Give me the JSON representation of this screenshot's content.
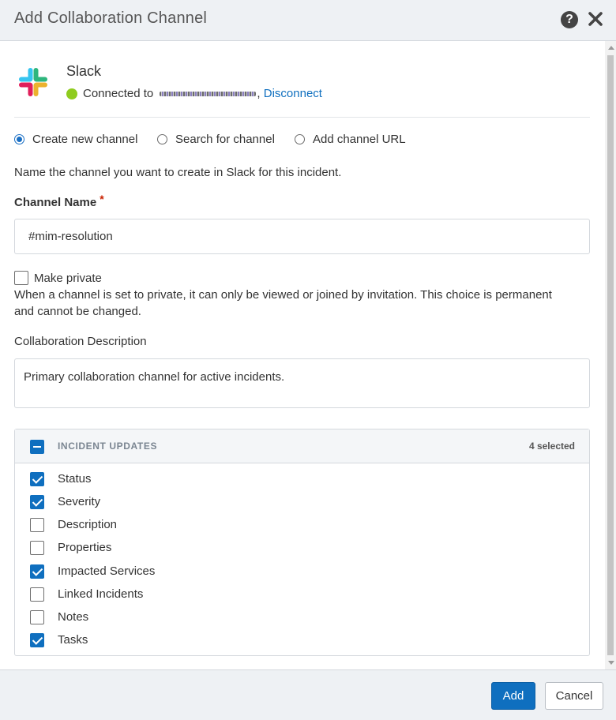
{
  "dialog": {
    "title": "Add Collaboration Channel",
    "help_icon": "question-circle-icon",
    "close_icon": "close-x-icon"
  },
  "integration": {
    "name": "Slack",
    "logo_icon": "slack-logo-icon",
    "status_color": "#8fcc1f",
    "connected_prefix": "Connected to",
    "connected_suffix": ",",
    "disconnect_label": "Disconnect"
  },
  "mode": {
    "options": [
      {
        "label": "Create new channel",
        "selected": true
      },
      {
        "label": "Search for channel",
        "selected": false
      },
      {
        "label": "Add channel URL",
        "selected": false
      }
    ]
  },
  "form": {
    "instruction": "Name the channel you want to create in Slack for this incident.",
    "channel_name_label": "Channel Name",
    "required_mark": "*",
    "channel_name_value": "#mim-resolution",
    "make_private_label": "Make private",
    "make_private_checked": false,
    "make_private_help": "When a channel is set to private, it can only be viewed or joined by invitation. This choice is permanent and cannot be changed.",
    "description_label": "Collaboration Description",
    "description_value": "Primary collaboration channel for active incidents."
  },
  "updates": {
    "header": "INCIDENT UPDATES",
    "selected_count": "4 selected",
    "items": [
      {
        "label": "Status",
        "checked": true
      },
      {
        "label": "Severity",
        "checked": true
      },
      {
        "label": "Description",
        "checked": false
      },
      {
        "label": "Properties",
        "checked": false
      },
      {
        "label": "Impacted Services",
        "checked": true
      },
      {
        "label": "Linked Incidents",
        "checked": false
      },
      {
        "label": "Notes",
        "checked": false
      },
      {
        "label": "Tasks",
        "checked": true
      }
    ]
  },
  "footer": {
    "add_label": "Add",
    "cancel_label": "Cancel"
  },
  "colors": {
    "primary": "#0f6fbf",
    "header_bg": "#eef1f4",
    "required": "#c92100"
  }
}
